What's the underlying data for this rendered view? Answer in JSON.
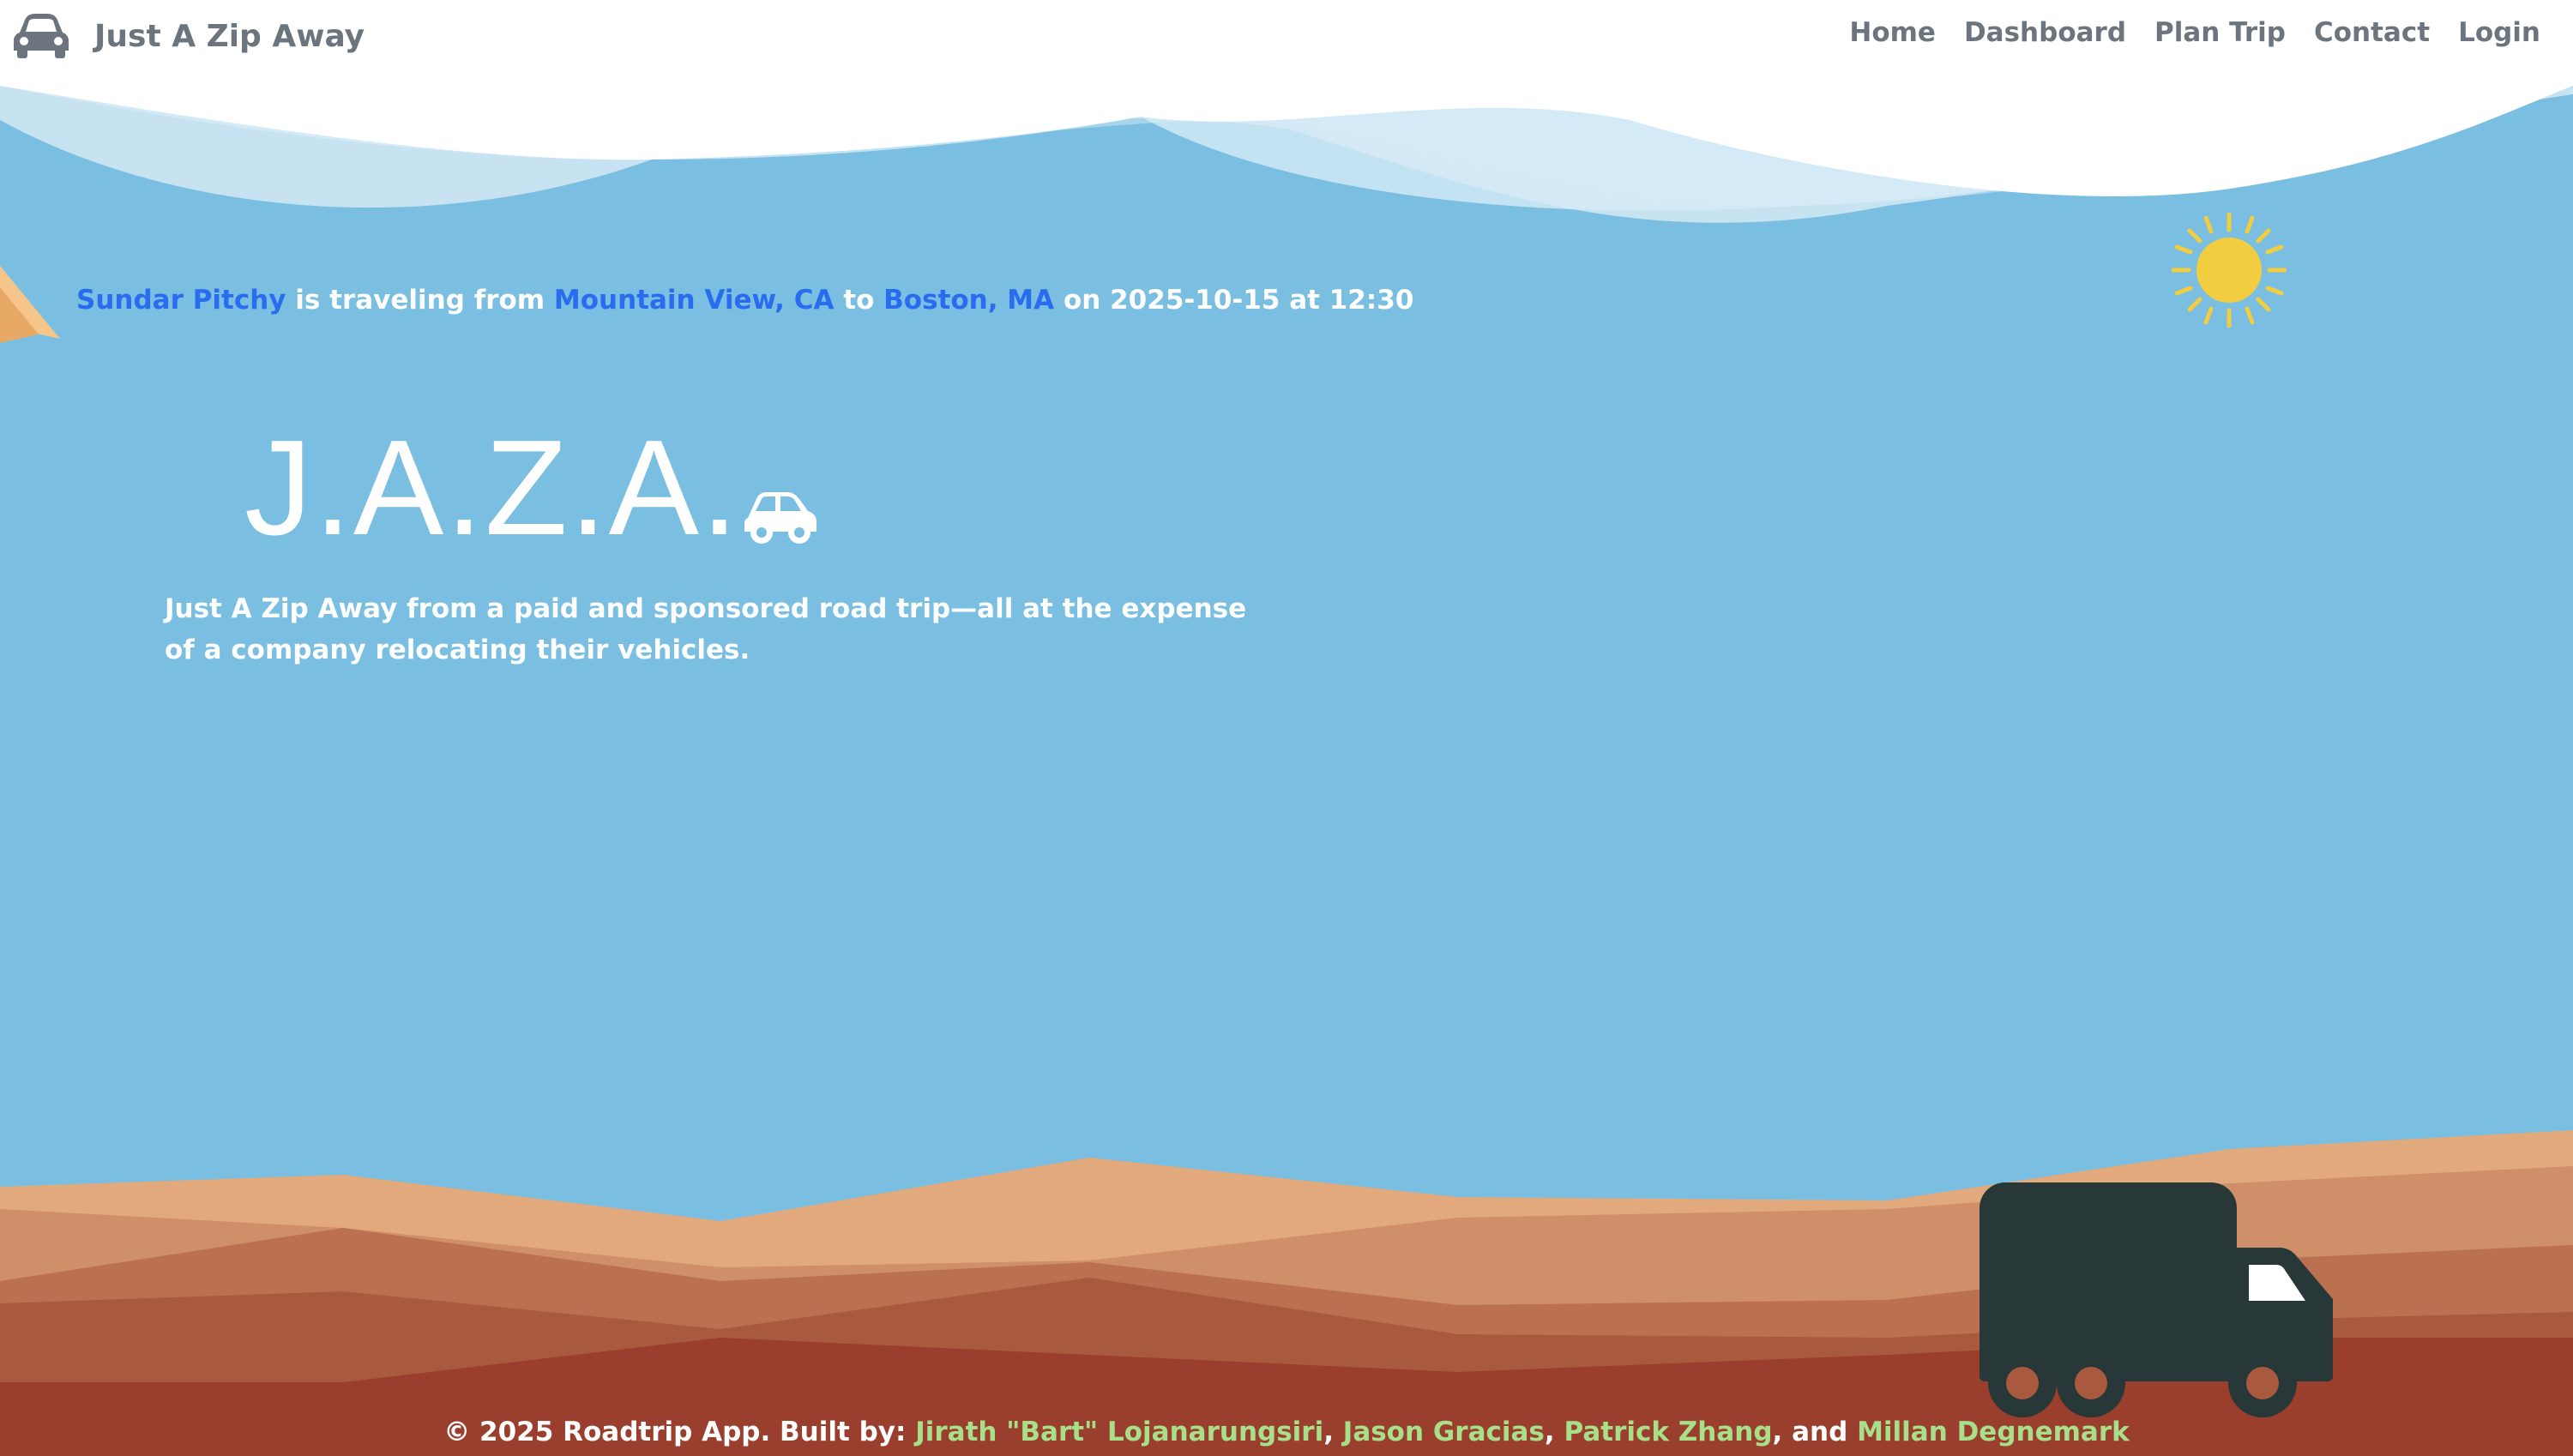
{
  "colors": {
    "sky": "#7abfe1",
    "link_blue": "#2a6cf0",
    "author_green": "#a8e08a",
    "nav_gray": "#6c757d",
    "sun_yellow": "#f2cd40",
    "truck_dark": "#283738"
  },
  "icons": {
    "brand": "car-front-icon",
    "hero": "car-side-icon",
    "sun": "sun-icon",
    "truck": "truck-icon",
    "plane": "paper-plane-icon"
  },
  "brand": {
    "name": "Just A Zip Away"
  },
  "nav": {
    "items": [
      {
        "label": "Home"
      },
      {
        "label": "Dashboard"
      },
      {
        "label": "Plan Trip"
      },
      {
        "label": "Contact"
      },
      {
        "label": "Login"
      }
    ]
  },
  "trip": {
    "traveler": "Sundar Pitchy",
    "text_traveling": " is traveling from ",
    "origin": "Mountain View, CA",
    "text_to": " to ",
    "destination": "Boston, MA",
    "text_on": " on ",
    "date": "2025-10-15",
    "text_at": " at ",
    "time": "12:30"
  },
  "hero": {
    "title": "J.A.Z.A.",
    "tagline": "Just A Zip Away from a paid and sponsored road trip—all at the expense of a company relocating their vehicles."
  },
  "footer": {
    "prefix": "© 2025 Roadtrip App. Built by: ",
    "authors": [
      "Jirath \"Bart\" Lojanarungsiri",
      "Jason Gracias",
      "Patrick Zhang",
      "Millan Degnemark"
    ],
    "sep1": ", ",
    "sep2": ", ",
    "sep3": ", and "
  }
}
